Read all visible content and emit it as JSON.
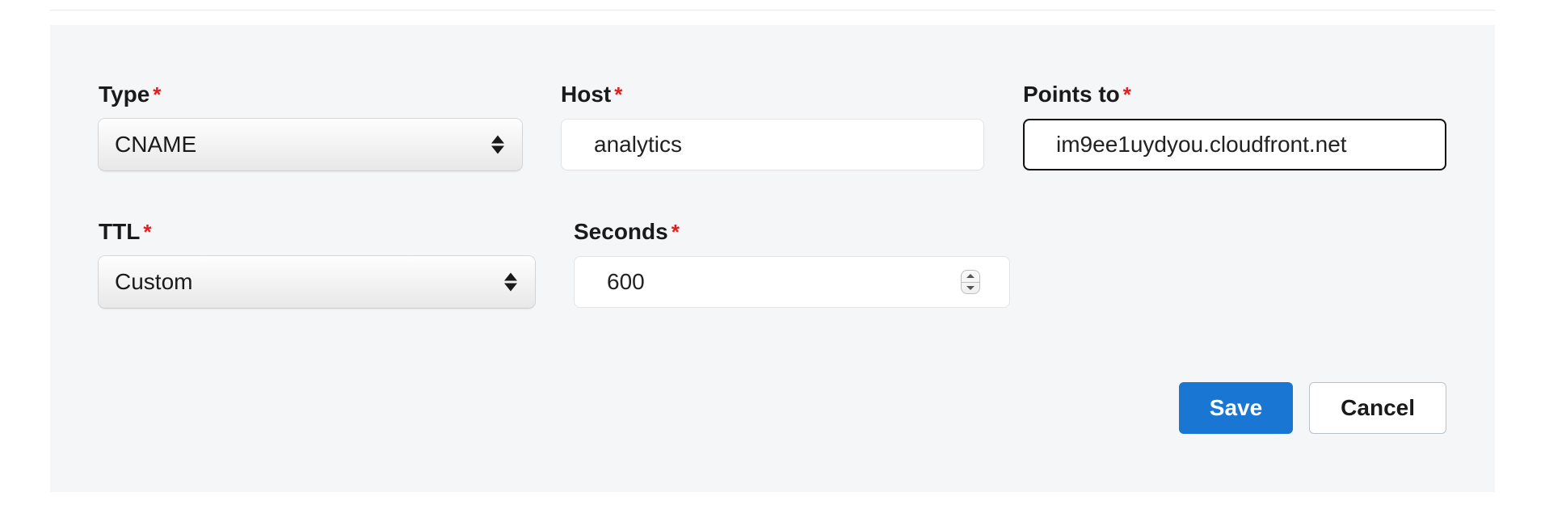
{
  "fields": {
    "type": {
      "label": "Type",
      "value": "CNAME"
    },
    "host": {
      "label": "Host",
      "value": "analytics"
    },
    "points_to": {
      "label": "Points to",
      "value": "im9ee1uydyou.cloudfront.net"
    },
    "ttl": {
      "label": "TTL",
      "value": "Custom"
    },
    "seconds": {
      "label": "Seconds",
      "value": "600"
    }
  },
  "required_mark": "*",
  "buttons": {
    "save": "Save",
    "cancel": "Cancel"
  }
}
